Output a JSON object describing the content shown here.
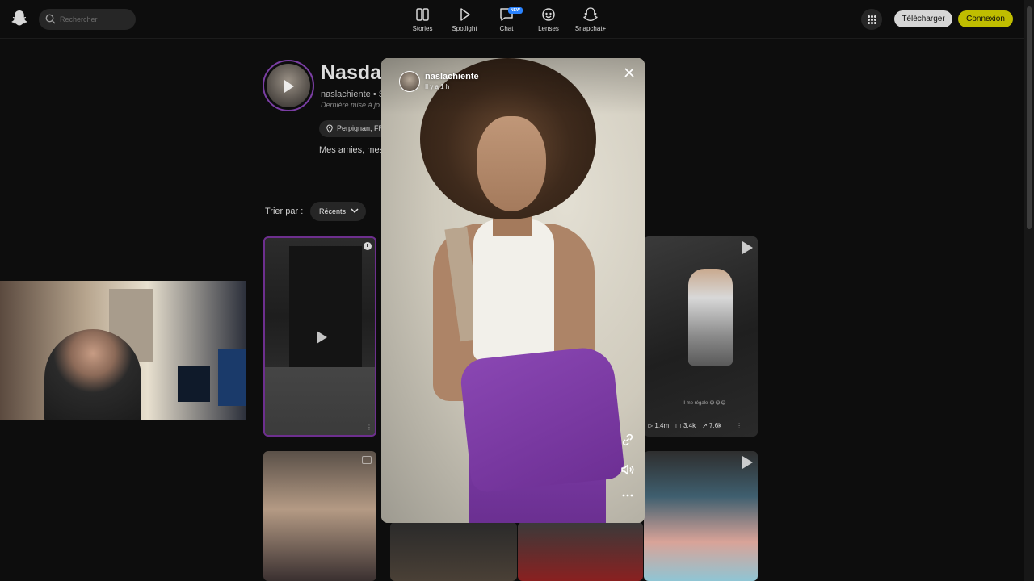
{
  "topbar": {
    "search_placeholder": "Rechercher",
    "nav": [
      {
        "label": "Stories",
        "icon": "stories-icon"
      },
      {
        "label": "Spotlight",
        "icon": "spotlight-icon"
      },
      {
        "label": "Chat",
        "icon": "chat-icon",
        "badge": "NEW"
      },
      {
        "label": "Lenses",
        "icon": "lenses-icon"
      },
      {
        "label": "Snapchat+",
        "icon": "snapchat-plus-icon"
      }
    ],
    "download_label": "Télécharger",
    "login_label": "Connexion"
  },
  "profile": {
    "name": "Nasdas",
    "handle": "naslachiente • S",
    "updated": "Dernière mise à jo",
    "location": "Perpignan, FR",
    "bio": "Mes amies, mes"
  },
  "sort": {
    "label": "Trier par :",
    "selected": "Récents"
  },
  "grid": {
    "tile2_stats": {
      "views": "1.4m",
      "comments": "3.4k",
      "shares": "7.6k"
    },
    "tile2_caption": "Il me régale 😂😂😂"
  },
  "story_modal": {
    "username": "naslachiente",
    "time_ago": "Il y a 1 h"
  },
  "colors": {
    "brand_yellow": "#fffc00",
    "accent_purple": "#6d2f8e",
    "background": "#0d0d0d"
  }
}
